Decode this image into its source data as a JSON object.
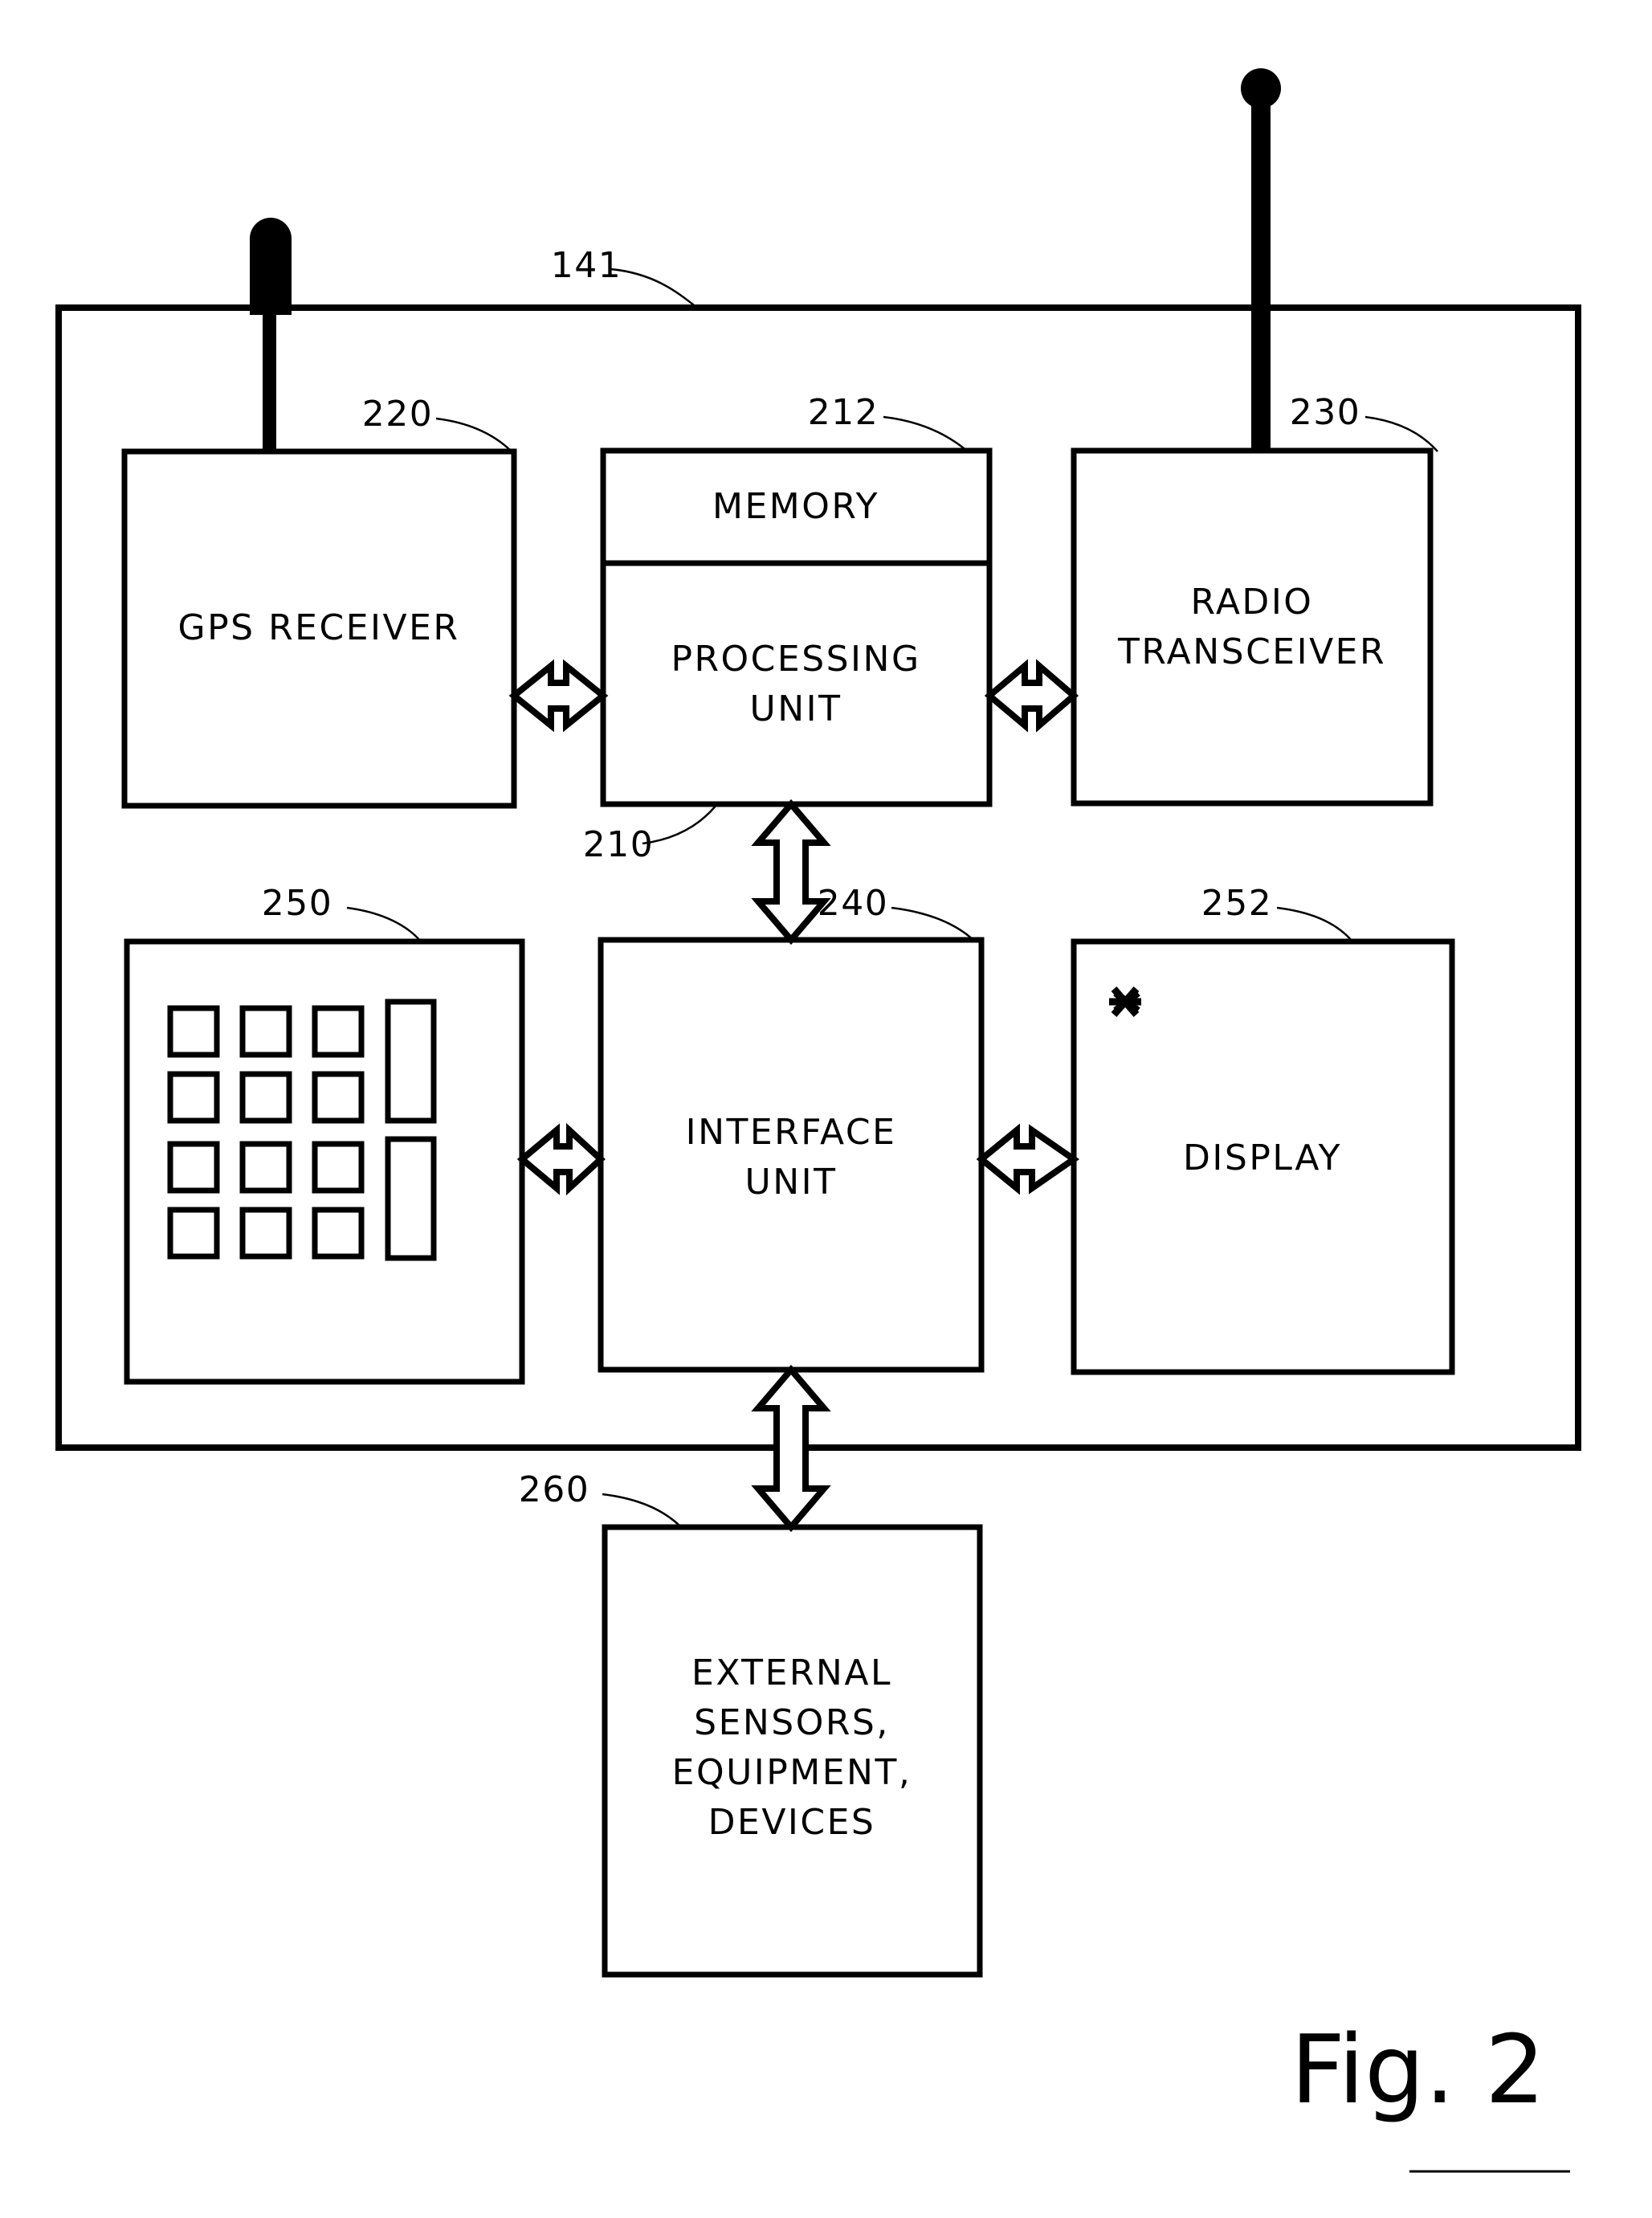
{
  "figure": {
    "caption": "Fig. 2",
    "outer_enclosure": {
      "ref": "141",
      "name": "mobile-device-enclosure"
    },
    "blocks": [
      {
        "id": "gps-receiver",
        "ref": "220",
        "label": "GPS RECEIVER",
        "label_lines": [
          "GPS RECEIVER"
        ]
      },
      {
        "id": "memory",
        "ref": "212",
        "label": "MEMORY",
        "label_lines": [
          "MEMORY"
        ]
      },
      {
        "id": "processing-unit",
        "ref": "210",
        "label": "PROCESSING UNIT",
        "label_lines": [
          "PROCESSING",
          "UNIT"
        ]
      },
      {
        "id": "radio-transceiver",
        "ref": "230",
        "label": "RADIO TRANSCEIVER",
        "label_lines": [
          "RADIO",
          "TRANSCEIVER"
        ]
      },
      {
        "id": "keypad",
        "ref": "250",
        "label": "",
        "label_lines": []
      },
      {
        "id": "interface-unit",
        "ref": "240",
        "label": "INTERFACE UNIT",
        "label_lines": [
          "INTERFACE",
          "UNIT"
        ]
      },
      {
        "id": "display",
        "ref": "252",
        "label": "DISPLAY",
        "label_lines": [
          "DISPLAY"
        ]
      },
      {
        "id": "external-devices",
        "ref": "260",
        "label": "EXTERNAL SENSORS, EQUIPMENT, DEVICES",
        "label_lines": [
          "EXTERNAL",
          "SENSORS,",
          "EQUIPMENT,",
          "DEVICES"
        ]
      }
    ],
    "icons": {
      "gps_antenna": "antenna-stub-icon",
      "radio_antenna": "antenna-whip-icon",
      "display_star": "asterisk-icon",
      "keypad_keys": "keypad-key-icon"
    },
    "connectors": [
      {
        "id": "gps-to-cpu",
        "kind": "double-arrow-horizontal"
      },
      {
        "id": "cpu-to-radio",
        "kind": "double-arrow-horizontal"
      },
      {
        "id": "cpu-to-interface",
        "kind": "double-arrow-vertical"
      },
      {
        "id": "keypad-to-interface",
        "kind": "double-arrow-horizontal"
      },
      {
        "id": "interface-to-display",
        "kind": "double-arrow-horizontal"
      },
      {
        "id": "interface-to-external",
        "kind": "double-arrow-vertical"
      }
    ],
    "colors": {
      "ink": "#000000",
      "paper": "#ffffff"
    }
  }
}
